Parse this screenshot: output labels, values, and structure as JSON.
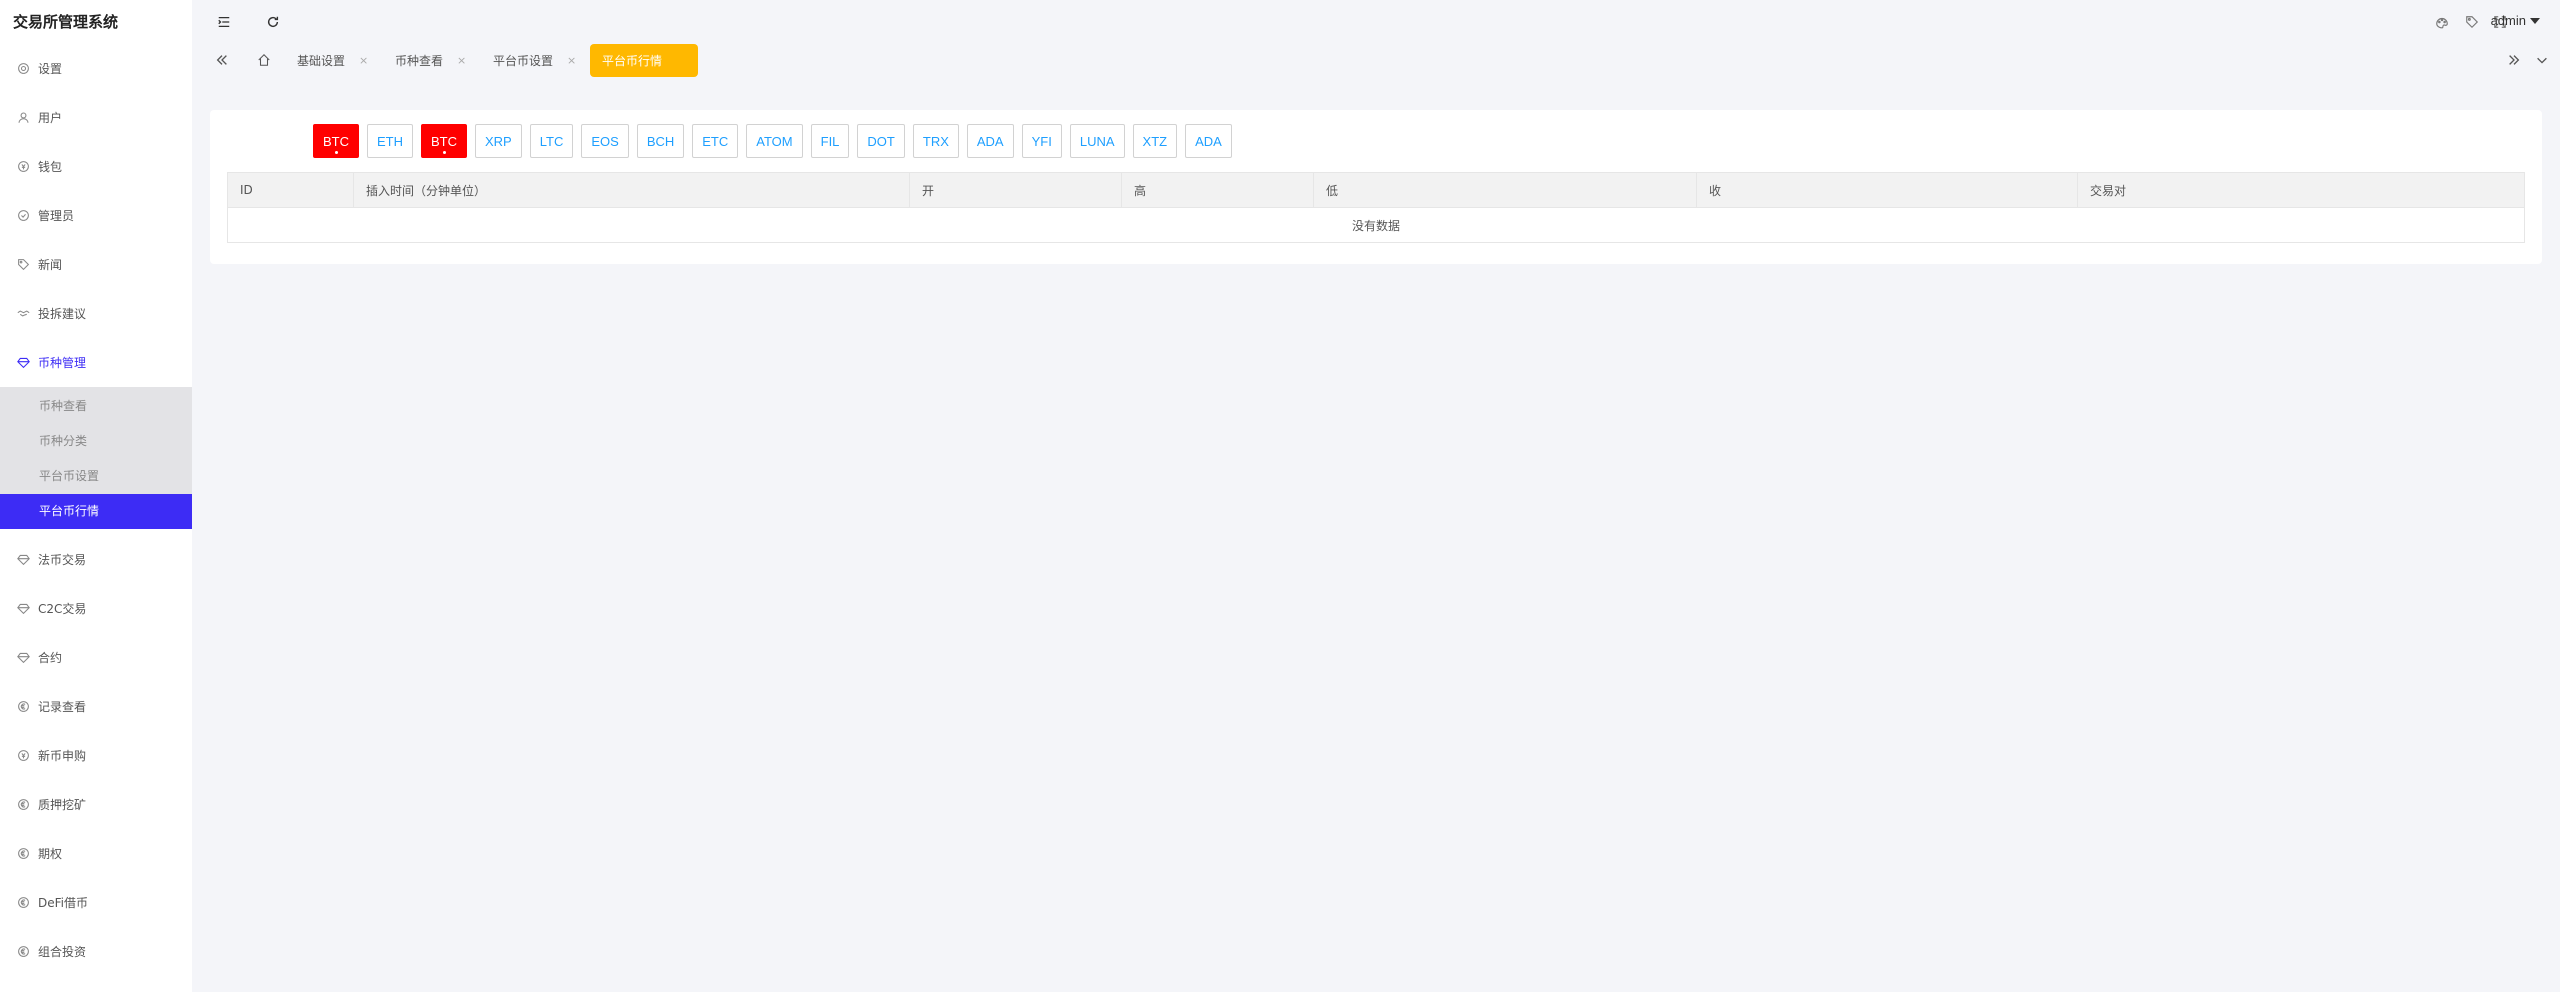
{
  "app": {
    "title": "交易所管理系统"
  },
  "sidebar": {
    "items": [
      {
        "label": "设置",
        "icon": "gear-icon"
      },
      {
        "label": "用户",
        "icon": "user-icon"
      },
      {
        "label": "钱包",
        "icon": "wallet-icon"
      },
      {
        "label": "管理员",
        "icon": "shield-icon"
      },
      {
        "label": "新闻",
        "icon": "tag-icon"
      },
      {
        "label": "投拆建议",
        "icon": "handshake-icon"
      },
      {
        "label": "币种管理",
        "icon": "diamond-icon"
      },
      {
        "label": "法币交易",
        "icon": "diamond-icon"
      },
      {
        "label": "C2C交易",
        "icon": "diamond-icon"
      },
      {
        "label": "合约",
        "icon": "diamond-icon"
      },
      {
        "label": "记录查看",
        "icon": "euro-icon"
      },
      {
        "label": "新币申购",
        "icon": "coin-icon"
      },
      {
        "label": "质押挖矿",
        "icon": "euro-icon"
      },
      {
        "label": "期权",
        "icon": "euro-icon"
      },
      {
        "label": "DeFi借币",
        "icon": "euro-icon"
      },
      {
        "label": "组合投资",
        "icon": "euro-icon"
      }
    ],
    "submenu": [
      {
        "label": "币种查看"
      },
      {
        "label": "币种分类"
      },
      {
        "label": "平台币设置"
      },
      {
        "label": "平台币行情"
      }
    ]
  },
  "topbar": {
    "user": "admin"
  },
  "tabs": [
    {
      "label": "基础设置",
      "close": "×"
    },
    {
      "label": "币种查看",
      "close": "×"
    },
    {
      "label": "平台币设置",
      "close": "×"
    },
    {
      "label": "平台币行情"
    }
  ],
  "coins": [
    "BTC",
    "ETH",
    "BTC",
    "XRP",
    "LTC",
    "EOS",
    "BCH",
    "ETC",
    "ATOM",
    "FIL",
    "DOT",
    "TRX",
    "ADA",
    "YFI",
    "LUNA",
    "XTZ",
    "ADA"
  ],
  "table": {
    "columns": [
      "ID",
      "插入时间（分钟单位）",
      "开",
      "高",
      "低",
      "收",
      "交易对"
    ],
    "empty_text": "没有数据"
  },
  "colors": {
    "accent": "#3d2cf5",
    "active_tab": "#ffb800",
    "active_coin": "#ff0000",
    "coin_text": "#1e9fff"
  }
}
